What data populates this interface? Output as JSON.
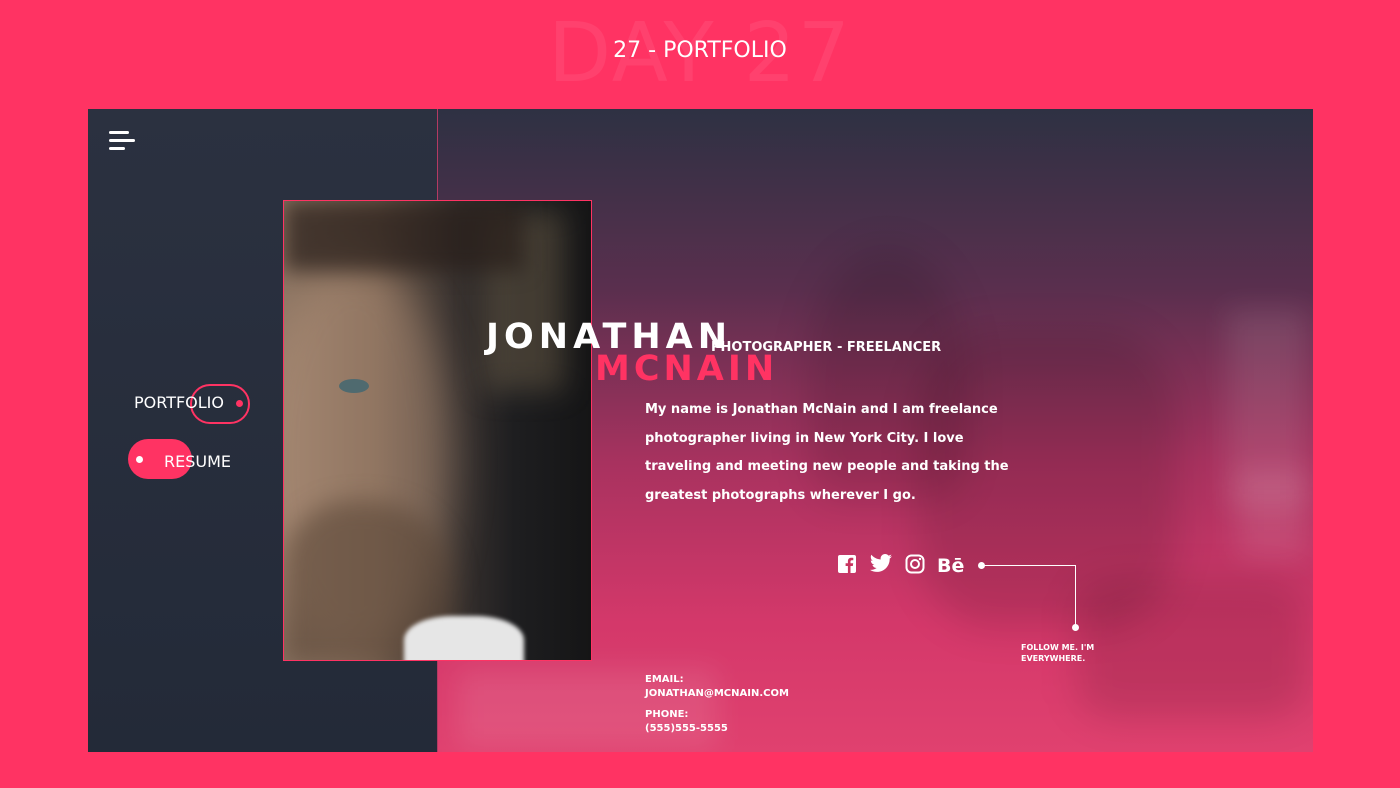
{
  "header": {
    "watermark": "DAY 27",
    "title": "27 - PORTFOLIO"
  },
  "sidebar": {
    "menu_icon": "hamburger-menu-icon",
    "items": [
      {
        "label": "PORTFOLIO",
        "state": "outlined"
      },
      {
        "label": "RESUME",
        "state": "active"
      }
    ]
  },
  "profile": {
    "first_name": "JONATHAN",
    "last_name": "MCNAIN",
    "subtitle": "PHOTOGRAPHER - FREELANCER",
    "bio": "My name is Jonathan McNain and I am freelance photographer living in New York City. I love traveling and meeting new people and taking the greatest photographs wherever I go."
  },
  "social": {
    "icons": [
      "facebook-icon",
      "twitter-icon",
      "instagram-icon",
      "behance-icon"
    ],
    "note": "FOLLOW ME. I'M EVERYWHERE."
  },
  "contact": {
    "email_label": "EMAIL:",
    "email": "JONATHAN@MCNAIN.COM",
    "phone_label": "PHONE:",
    "phone": "(555)555-5555"
  },
  "colors": {
    "accent": "#ff3363",
    "sidebar": "#262d3b",
    "text": "#ffffff"
  }
}
